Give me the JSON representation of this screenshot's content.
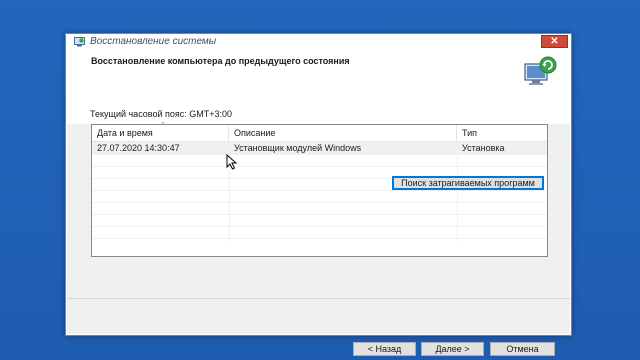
{
  "window": {
    "title": "Восстановление системы",
    "close_label": "✕"
  },
  "header": {
    "title": "Восстановление компьютера до предыдущего состояния"
  },
  "timezone": {
    "label": "Текущий часовой пояс: GMT+3:00"
  },
  "restore_list": {
    "columns": [
      "Дата и время",
      "Описание",
      "Тип"
    ],
    "rows": [
      {
        "date": "27.07.2020 14:30:47",
        "description": "Установщик модулей Windows",
        "type": "Установка",
        "selected": true
      }
    ]
  },
  "buttons": {
    "scan_label": "Поиск затрагиваемых программ",
    "back_label": "< Назад",
    "next_label": "Далее >",
    "cancel_label": "Отмена"
  },
  "colors": {
    "desktop": "#1f5fb3",
    "close": "#d04a3a",
    "focus": "#0078d7"
  }
}
